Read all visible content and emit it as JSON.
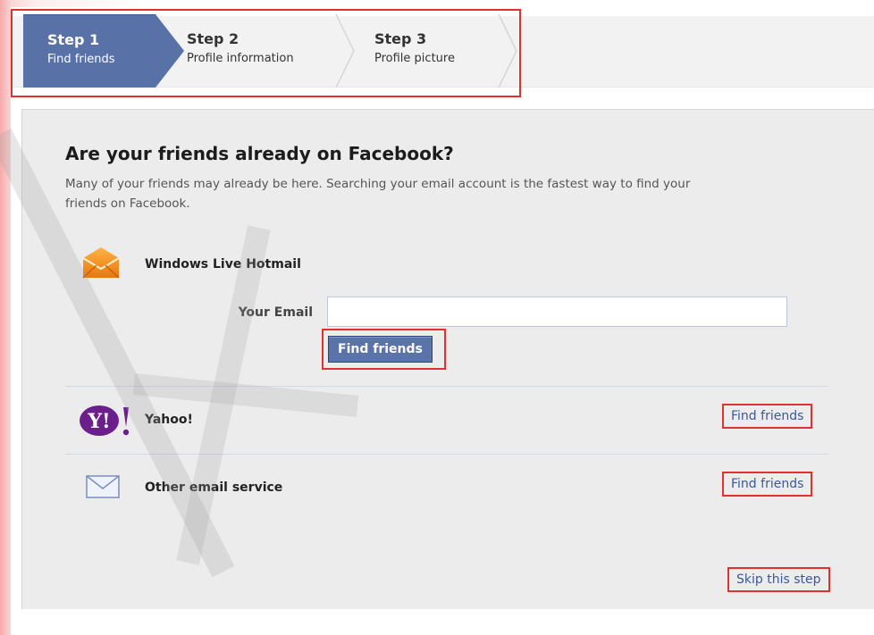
{
  "steps": [
    {
      "num": "Step 1",
      "desc": "Find friends"
    },
    {
      "num": "Step 2",
      "desc": "Profile information"
    },
    {
      "num": "Step 3",
      "desc": "Profile picture"
    }
  ],
  "main": {
    "heading": "Are your friends already on Facebook?",
    "subtext": "Many of your friends may already be here. Searching your email account is the fastest way to find your friends on Facebook."
  },
  "hotmail": {
    "name": "Windows Live Hotmail",
    "email_label": "Your Email",
    "email_value": "",
    "button_label": "Find friends",
    "icon": "hotmail-envelope-icon"
  },
  "yahoo": {
    "name": "Yahoo!",
    "link_label": "Find friends",
    "icon": "yahoo-logo-icon"
  },
  "other": {
    "name": "Other email service",
    "link_label": "Find friends",
    "icon": "mail-envelope-icon"
  },
  "footer": {
    "skip_label": "Skip this step"
  },
  "colors": {
    "brand_blue": "#3b5998",
    "step_active_bg": "#5872a7",
    "highlight_red": "#e03030",
    "content_bg": "#ececec"
  }
}
